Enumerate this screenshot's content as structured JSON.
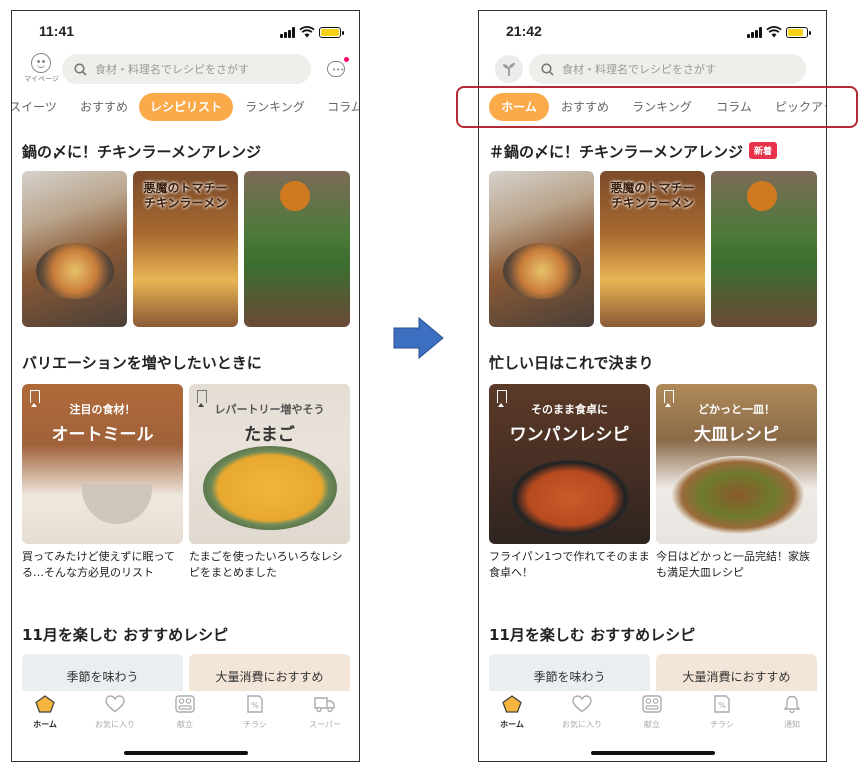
{
  "left": {
    "time": "11:41",
    "mypage_label": "マイページ",
    "search_placeholder": "食材・料理名でレシピをさがす",
    "tabs": [
      "スイーツ",
      "おすすめ",
      "レシピリスト",
      "ランキング",
      "コラム"
    ],
    "active_tab": "レシピリスト",
    "section1_title": "鍋の〆に！チキンラーメンアレンジ",
    "thumb_text": "悪魔のトマチー\nチキンラーメン",
    "section2_title": "バリエーションを増やしたいときに",
    "cards": [
      {
        "sub": "注目の食材！",
        "main": "オートミール",
        "caption": "買ってみたけど使えずに眠ってる…そんな方必見のリスト"
      },
      {
        "sub": "レパートリー増やそう",
        "main": "たまご",
        "caption": "たまごを使ったいろいろなレシピをまとめました"
      }
    ],
    "section3_title": "11月を楽しむ おすすめレシピ",
    "season": [
      "季節を味わう",
      "大量消費におすすめ"
    ],
    "tabbar": [
      "ホーム",
      "お気に入り",
      "献立",
      "チラシ",
      "スーパー"
    ]
  },
  "right": {
    "time": "21:42",
    "search_placeholder": "食材・料理名でレシピをさがす",
    "tabs": [
      "ホーム",
      "おすすめ",
      "ランキング",
      "コラム",
      "ピックアップ"
    ],
    "active_tab": "ホーム",
    "section1_title": "＃鍋の〆に！チキンラーメンアレンジ",
    "new_badge": "新着",
    "thumb_text": "悪魔のトマチー\nチキンラーメン",
    "section2_title": "忙しい日はこれで決まり",
    "cards": [
      {
        "sub": "そのまま食卓に",
        "main": "ワンパンレシピ",
        "caption": "フライパン1つで作れてそのまま食卓へ！"
      },
      {
        "sub": "どかっと一皿！",
        "main": "大皿レシピ",
        "caption": "今日はどかっと一品完結！家族も満足大皿レシピ"
      }
    ],
    "section3_title": "11月を楽しむ おすすめレシピ",
    "season": [
      "季節を味わう",
      "大量消費におすすめ"
    ],
    "tabbar": [
      "ホーム",
      "お気に入り",
      "献立",
      "チラシ",
      "通知"
    ]
  },
  "colors": {
    "accent": "#fbaa4a",
    "highlight_box": "#b42b35",
    "arrow": "#3d6fc0",
    "badge": "#e8344a"
  }
}
